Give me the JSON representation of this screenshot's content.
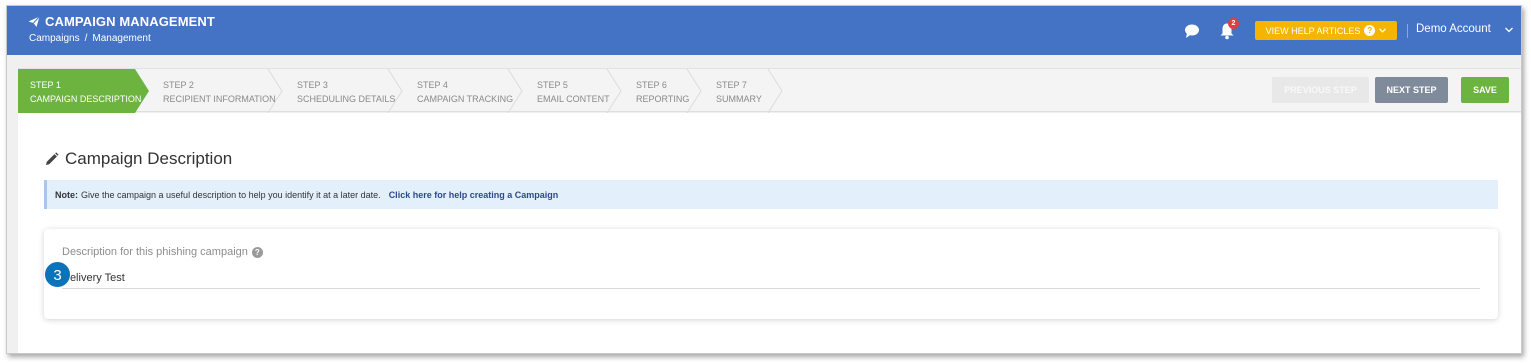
{
  "header": {
    "title": "CAMPAIGN MANAGEMENT",
    "breadcrumb": [
      "Campaigns",
      "/",
      "Management"
    ],
    "notification_count": "2",
    "help_button": "VIEW HELP ARTICLES",
    "account": "Demo Account"
  },
  "steps": [
    {
      "num": "STEP 1",
      "label": "CAMPAIGN DESCRIPTION",
      "active": true
    },
    {
      "num": "STEP 2",
      "label": "RECIPIENT INFORMATION",
      "active": false
    },
    {
      "num": "STEP 3",
      "label": "SCHEDULING DETAILS",
      "active": false
    },
    {
      "num": "STEP 4",
      "label": "CAMPAIGN TRACKING",
      "active": false
    },
    {
      "num": "STEP 5",
      "label": "EMAIL CONTENT",
      "active": false
    },
    {
      "num": "STEP 6",
      "label": "REPORTING",
      "active": false
    },
    {
      "num": "STEP 7",
      "label": "SUMMARY",
      "active": false
    }
  ],
  "actions": {
    "previous": "PREVIOUS STEP",
    "next": "NEXT STEP",
    "save": "SAVE"
  },
  "main": {
    "title": "Campaign Description",
    "note_prefix": "Note:",
    "note_text": "Give the campaign a useful description to help you identify it at a later date.",
    "note_link": "Click here for help creating a Campaign",
    "field_label": "Description for this phishing campaign",
    "field_value": "Delivery Test",
    "callout_number": "3"
  },
  "colors": {
    "header": "#4472c4",
    "active_step": "#6cb33f",
    "help_button": "#f5b400",
    "callout": "#0b74b8"
  }
}
